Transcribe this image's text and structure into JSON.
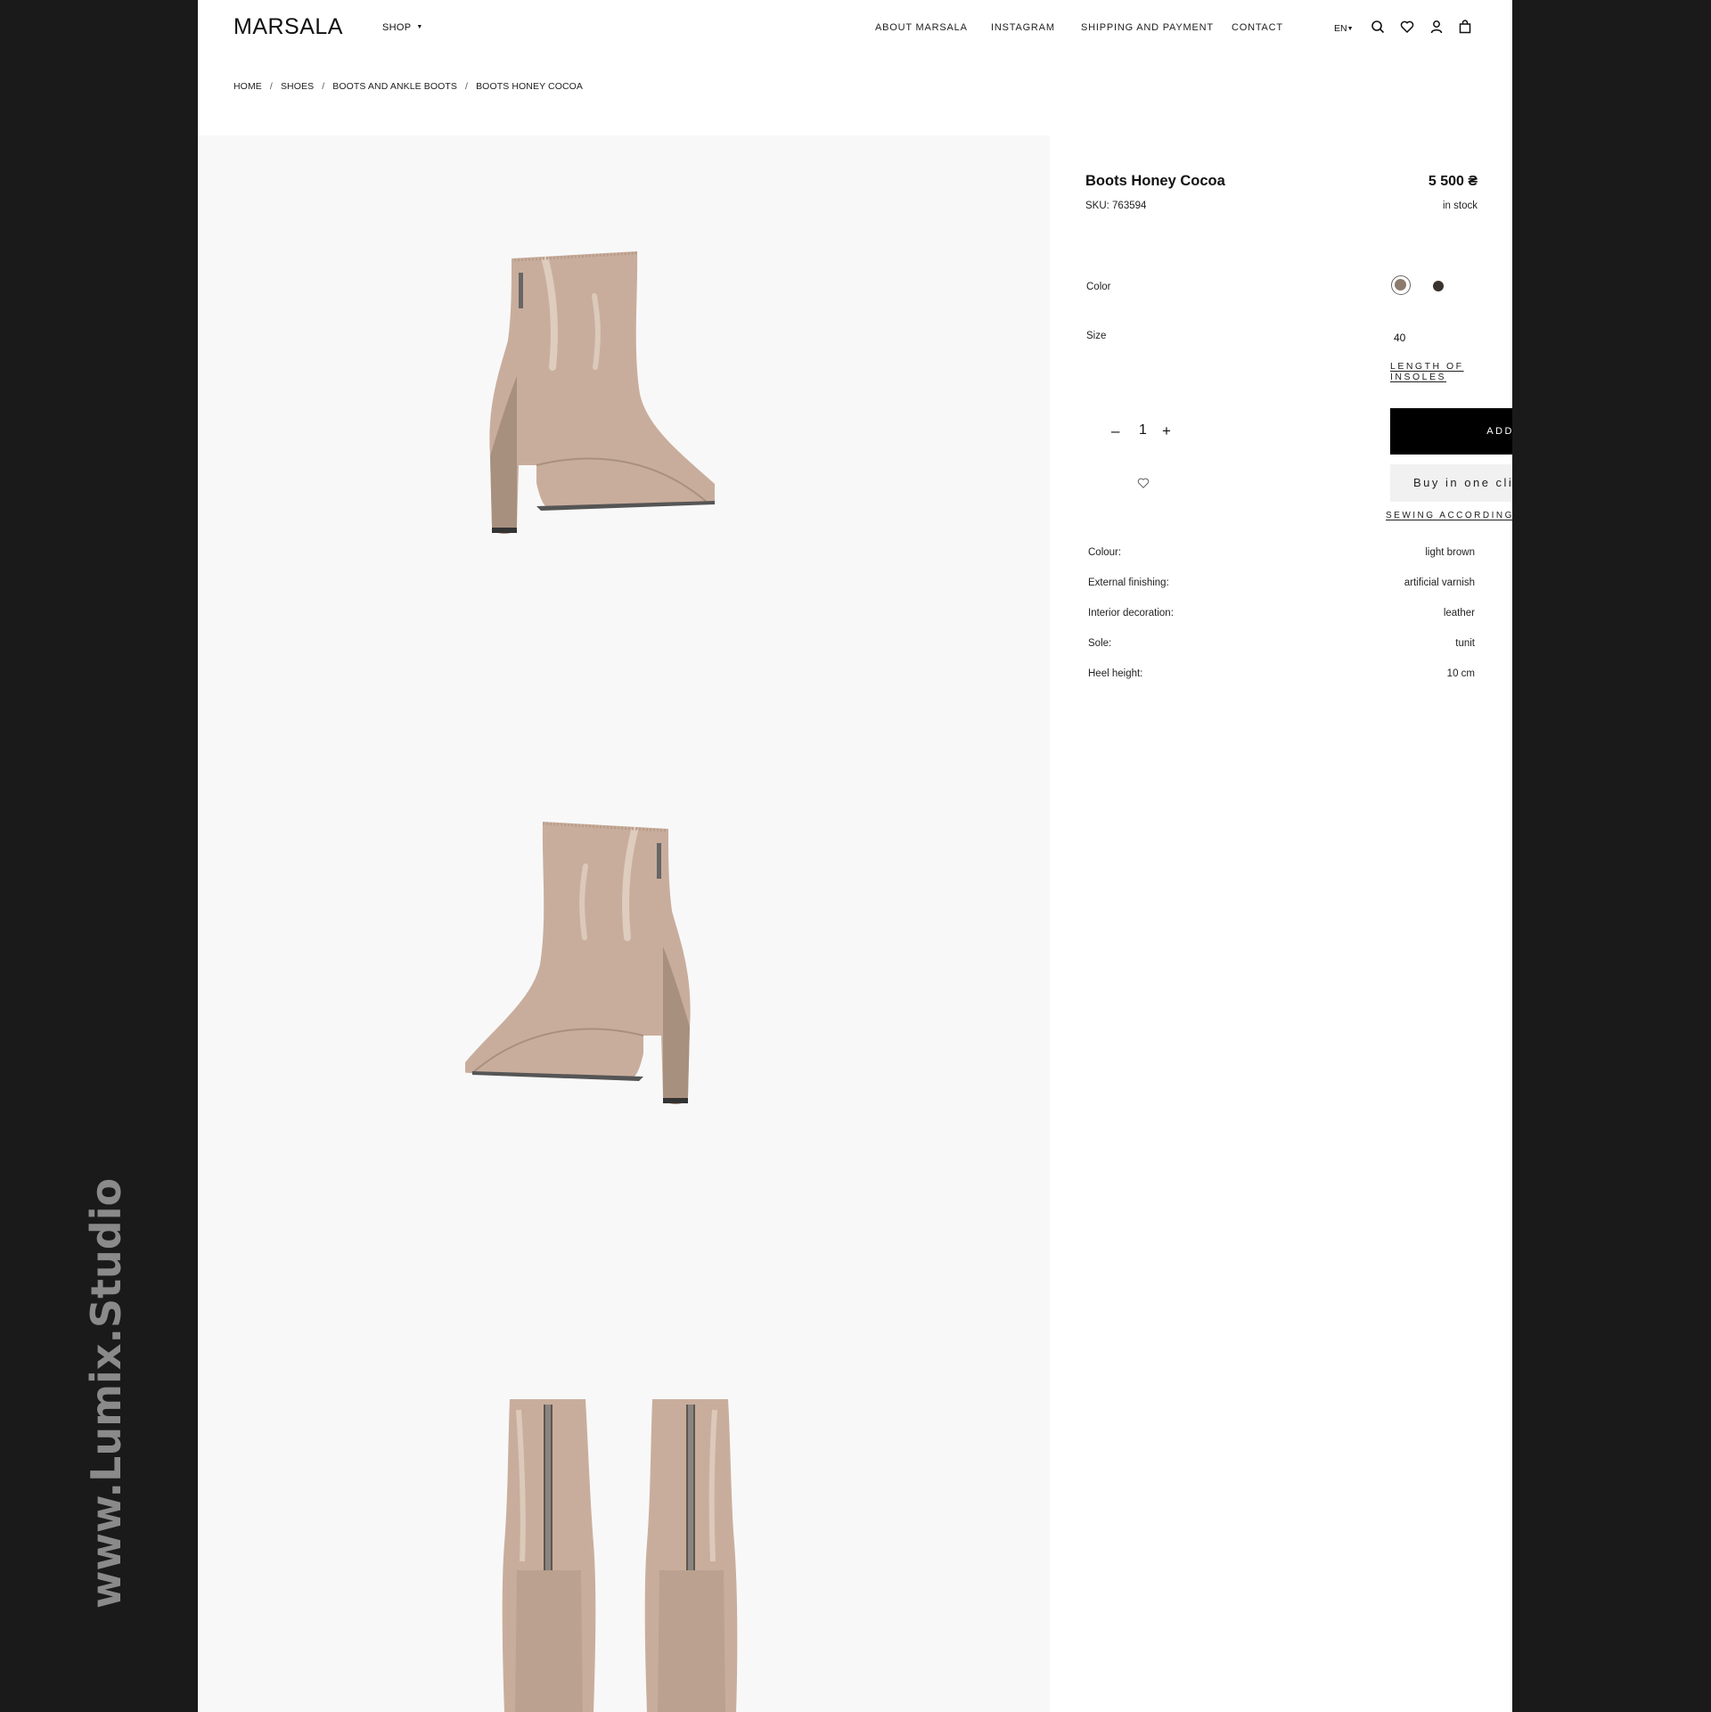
{
  "watermark": "www.Lumix.Studio",
  "header": {
    "logo": "MARSALA",
    "shop_label": "SHOP",
    "nav": [
      "ABOUT MARSALA",
      "INSTAGRAM",
      "SHIPPING AND PAYMENT",
      "CONTACT"
    ],
    "language": "EN"
  },
  "breadcrumb": [
    "HOME",
    "SHOES",
    "BOOTS AND ANKLE BOOTS",
    "BOOTS HONEY COCOA"
  ],
  "product": {
    "title": "Boots Honey Cocoa",
    "price": "5 500 ₴",
    "sku": "SKU: 763594",
    "stock": "in stock",
    "color_label": "Color",
    "colors": [
      "#8c7a6c",
      "#3a322d"
    ],
    "size_label": "Size",
    "size_value": "40",
    "insoles_link": "LENGTH OF INSOLES",
    "quantity": "1",
    "add_to_cart": "ADD TO CART",
    "buy_one_click": "Buy in one click",
    "sewing_link": "SEWING ACCORDING TO MY MEASUREMENTS",
    "specs": [
      {
        "key": "Colour:",
        "value": "light brown"
      },
      {
        "key": "External finishing:",
        "value": "artificial varnish"
      },
      {
        "key": "Interior decoration:",
        "value": "leather"
      },
      {
        "key": "Sole:",
        "value": "tunit"
      },
      {
        "key": "Heel height:",
        "value": "10 cm"
      }
    ]
  },
  "colors": {
    "boot": "#c9ad9c",
    "boot_shadow": "#a8907f",
    "accent": "#000000"
  }
}
